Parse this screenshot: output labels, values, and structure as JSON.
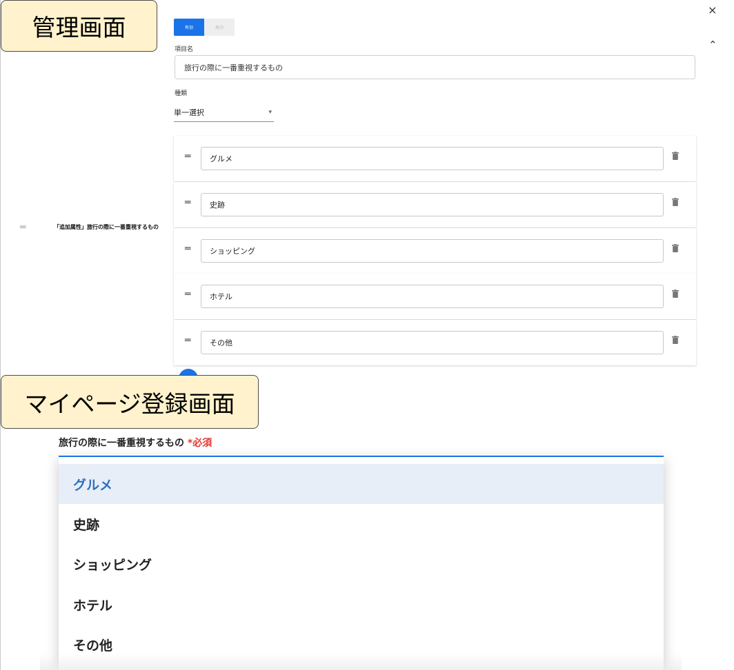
{
  "callouts": {
    "admin": "管理画面",
    "mypage": "マイページ登録画面"
  },
  "window": {
    "close_icon": "×",
    "collapse_icon": "⌃"
  },
  "toggle": {
    "on_label": "有効",
    "off_label": "無効",
    "active": "on"
  },
  "form": {
    "name_label": "項目名",
    "name_value": "旅行の際に一番重視するもの",
    "type_label": "種類",
    "type_value": "単一選択",
    "caret": "▾"
  },
  "attribute_list": {
    "drag_icon": "═",
    "title": "「追加属性」旅行の際に一番重視するもの"
  },
  "options": [
    {
      "label": "グルメ",
      "drag": "═"
    },
    {
      "label": "史跡",
      "drag": "═"
    },
    {
      "label": "ショッピング",
      "drag": "═"
    },
    {
      "label": "ホテル",
      "drag": "═"
    },
    {
      "label": "その他",
      "drag": "═"
    }
  ],
  "icons": {
    "trash": "trash-icon",
    "add": "add-fab"
  },
  "colors": {
    "primary": "#1a73e8",
    "required": "#e53935",
    "callout_bg": "#fff2cc",
    "selected_bg": "#e8eef7",
    "selected_text": "#2f6fc0"
  },
  "mypage": {
    "question": "旅行の際に一番重視するもの",
    "required_mark": "*必須",
    "dropdown_items": [
      "グルメ",
      "史跡",
      "ショッピング",
      "ホテル",
      "その他"
    ],
    "selected_index": 0
  }
}
